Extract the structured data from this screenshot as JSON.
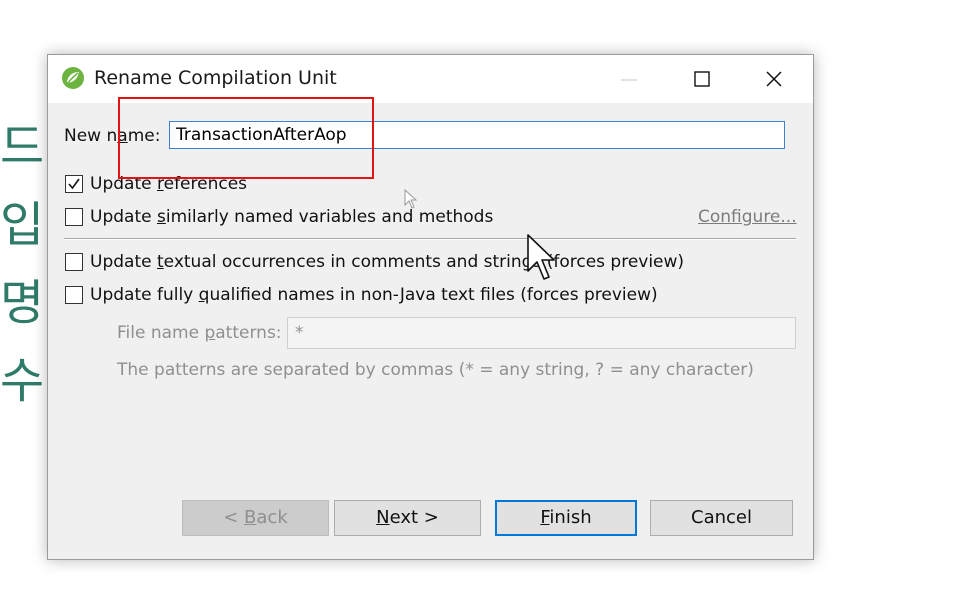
{
  "background": {
    "glyphs": [
      "드",
      "입",
      "명",
      "수"
    ],
    "glyph_color": "#2f7a68"
  },
  "dialog": {
    "title": "Rename Compilation Unit",
    "app_icon": "eclipse-spring-leaf-icon",
    "window_controls": [
      "minimize-icon",
      "maximize-icon",
      "close-icon"
    ],
    "new_name": {
      "label_prefix": "New n",
      "label_mnemonic": "a",
      "label_suffix": "me:",
      "value": "TransactionAfterAop"
    },
    "options": {
      "update_references": {
        "prefix": "Update ",
        "mnemonic": "r",
        "suffix": "eferences",
        "checked": true
      },
      "update_similar": {
        "prefix": "Update ",
        "mnemonic": "s",
        "suffix": "imilarly named variables and methods",
        "checked": false
      },
      "configure_link": "Configure...",
      "update_textual": {
        "prefix": "Update ",
        "mnemonic": "t",
        "suffix": "extual occurrences in comments and strings (forces preview)",
        "checked": false
      },
      "update_qualified": {
        "prefix": "Update fully ",
        "mnemonic": "q",
        "suffix": "ualified names in non-Java text files (forces preview)",
        "checked": false
      }
    },
    "file_patterns": {
      "label_prefix": "File name ",
      "label_mnemonic": "p",
      "label_suffix": "atterns:",
      "value": "*",
      "hint": "The patterns are separated by commas (* = any string, ? = any character)"
    },
    "buttons": {
      "back": {
        "prefix": "< ",
        "mnemonic": "B",
        "suffix": "ack"
      },
      "next": {
        "prefix": "",
        "mnemonic": "N",
        "suffix": "ext >"
      },
      "finish": {
        "prefix": "",
        "mnemonic": "F",
        "suffix": "inish"
      },
      "cancel": "Cancel"
    }
  },
  "annotation_color": "#e11414",
  "accent_color": "#0078d7"
}
